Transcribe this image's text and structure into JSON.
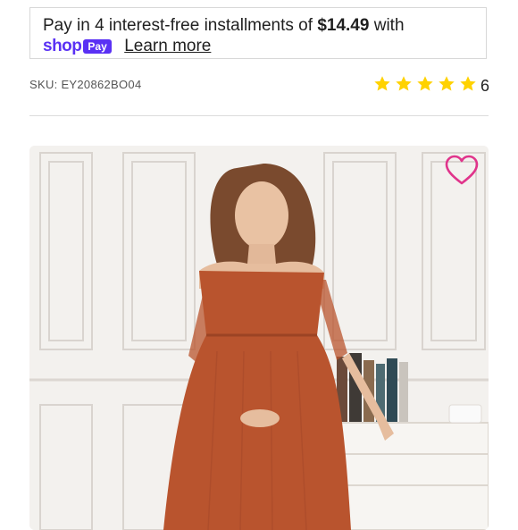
{
  "installments": {
    "prefix": "Pay in 4 interest-free installments of",
    "amount": "$14.49",
    "suffix": "with",
    "shop_logo": "shop",
    "pay_badge": "Pay",
    "learn_more": "Learn more"
  },
  "product": {
    "sku": "SKU: EY20862BO04",
    "rating": 5,
    "rating_count": "6",
    "image_icon": "product-photo"
  },
  "colors": {
    "shop_pay": "#5a31f4",
    "star": "#ffd200",
    "wishlist": "#e0348b",
    "dress": "#b9542e"
  }
}
